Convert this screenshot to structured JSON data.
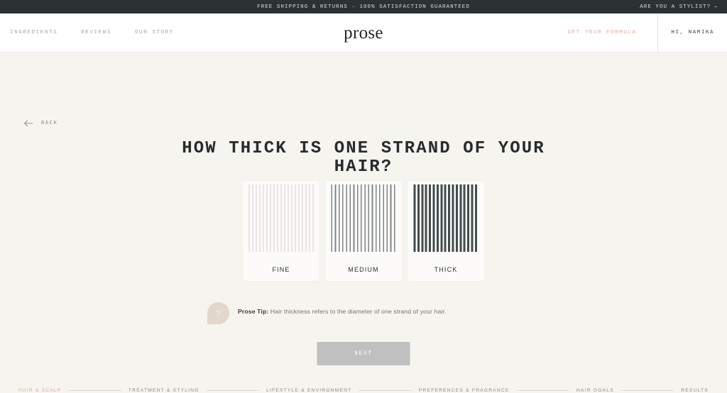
{
  "announcement": {
    "message": "FREE SHIPPING & RETURNS · 100% SATISFACTION GUARANTEED",
    "stylist_link": "ARE YOU A STYLIST?",
    "stylist_arrow": "→",
    "background": "#2b3233"
  },
  "header": {
    "nav": [
      {
        "label": "INGREDIENTS"
      },
      {
        "label": "REVIEWS"
      },
      {
        "label": "OUR STORY"
      }
    ],
    "brand": "prose",
    "cta": "GET YOUR FORMULA",
    "cta_color": "#e8a590",
    "account": "HI, NAMIKA"
  },
  "quiz": {
    "back_label": "BACK",
    "question": "HOW THICK IS ONE STRAND OF YOUR HAIR?",
    "options": [
      {
        "label": "FINE",
        "selected": false
      },
      {
        "label": "MEDIUM",
        "selected": false
      },
      {
        "label": "THICK",
        "selected": false
      }
    ],
    "tip": {
      "icon": "?",
      "title": "Prose Tip:",
      "body": "Hair thickness refers to the diameter of one strand of your hair."
    },
    "next_label": "NEXT",
    "next_disabled": true
  },
  "progress": {
    "steps": [
      {
        "label": "HAIR & SCALP",
        "active": true
      },
      {
        "label": "TREATMENT & STYLING",
        "active": false
      },
      {
        "label": "LIFESTYLE & ENVIRONMENT",
        "active": false
      },
      {
        "label": "PREFERENCES & FRAGRANCE",
        "active": false
      },
      {
        "label": "HAIR GOALS",
        "active": false
      },
      {
        "label": "RESULTS",
        "active": false
      }
    ],
    "active_color": "#e8a590"
  }
}
